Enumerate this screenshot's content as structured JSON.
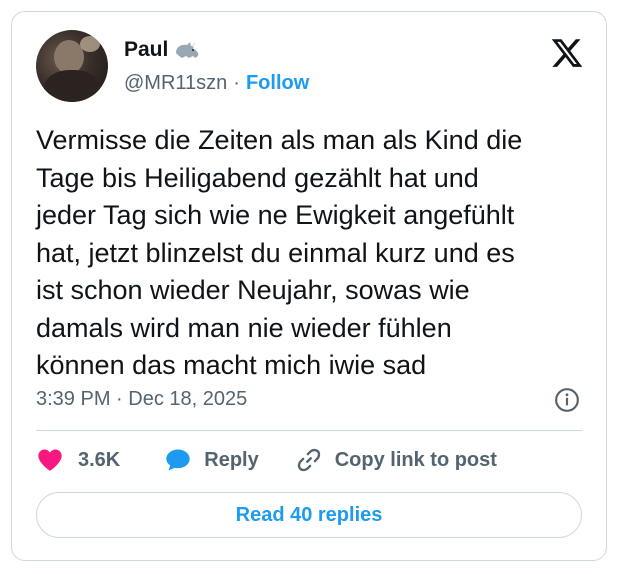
{
  "author": {
    "name": "Paul",
    "handle": "@MR11szn",
    "separator": "·",
    "follow_label": "Follow"
  },
  "tweet": {
    "text": "Vermisse die Zeiten als man als Kind die\nTage bis Heiligabend gezählt hat und\njeder Tag sich wie ne Ewigkeit angefühlt\nhat, jetzt blinzelst du einmal kurz und es\nist schon wieder Neujahr, sowas wie\ndamals wird man nie wieder fühlen\nkönnen das macht mich iwie sad",
    "timestamp": "3:39 PM · Dec 18, 2025"
  },
  "actions": {
    "likes_count": "3.6K",
    "reply_label": "Reply",
    "copy_link_label": "Copy link to post"
  },
  "read_replies_label": "Read 40 replies",
  "icons": {
    "verified_emoji": "rhino-icon",
    "brand": "x-logo-icon",
    "info": "info-icon",
    "like": "heart-icon",
    "reply": "speech-bubble-icon",
    "copy": "link-icon"
  },
  "colors": {
    "accent": "#1d9bf0",
    "like": "#f91880",
    "text": "#0f1419",
    "muted": "#536471",
    "border": "#cfd9de"
  }
}
